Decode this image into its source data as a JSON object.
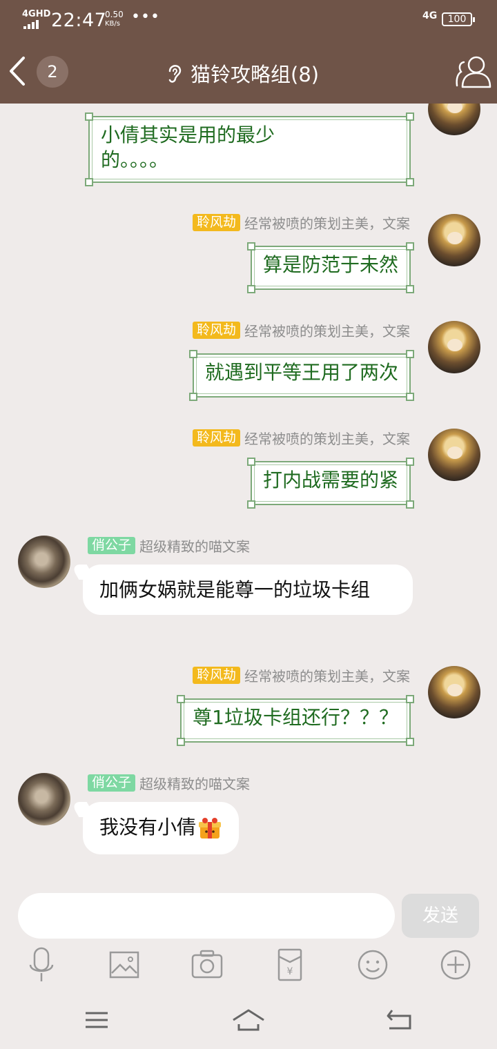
{
  "status_bar": {
    "signal_label": "4GHD",
    "time": "22:47",
    "speed_value": "0.50",
    "speed_unit": "KB/s",
    "more": "•••",
    "network": "4G",
    "battery": "100"
  },
  "header": {
    "unread_count": "2",
    "title": "猫铃攻略组(8)"
  },
  "messages": [
    {
      "side": "right",
      "text": "小倩其实是用的最少的。。。。"
    },
    {
      "side": "right",
      "tag": "聆风劫",
      "nickname": "经常被喷的策划主美，文案",
      "text": "算是防范于未然"
    },
    {
      "side": "right",
      "tag": "聆风劫",
      "nickname": "经常被喷的策划主美，文案",
      "text": "就遇到平等王用了两次"
    },
    {
      "side": "right",
      "tag": "聆风劫",
      "nickname": "经常被喷的策划主美，文案",
      "text": "打内战需要的紧"
    },
    {
      "side": "left",
      "tag": "俏公子",
      "nickname": "超级精致的喵文案",
      "text": "加俩女娲就是能尊一的垃圾卡组"
    },
    {
      "side": "right",
      "tag": "聆风劫",
      "nickname": "经常被喷的策划主美，文案",
      "text": "尊1垃圾卡组还行？？？"
    },
    {
      "side": "left",
      "tag": "俏公子",
      "nickname": "超级精致的喵文案",
      "text": "我没有小倩"
    }
  ],
  "composer": {
    "placeholder": "",
    "send_label": "发送"
  },
  "toolbar_icons": [
    "microphone-icon",
    "image-icon",
    "camera-icon",
    "red-envelope-icon",
    "emoji-icon",
    "plus-icon"
  ],
  "nav_icons": [
    "menu-icon",
    "home-icon",
    "back-icon"
  ],
  "colors": {
    "header_bg": "#6f5448",
    "chat_bg": "#efebea",
    "bubble_border": "#7ca979",
    "bubble_text": "#1f6b20",
    "tag_gold": "#f3b91d",
    "tag_green": "#7ed8a2"
  }
}
